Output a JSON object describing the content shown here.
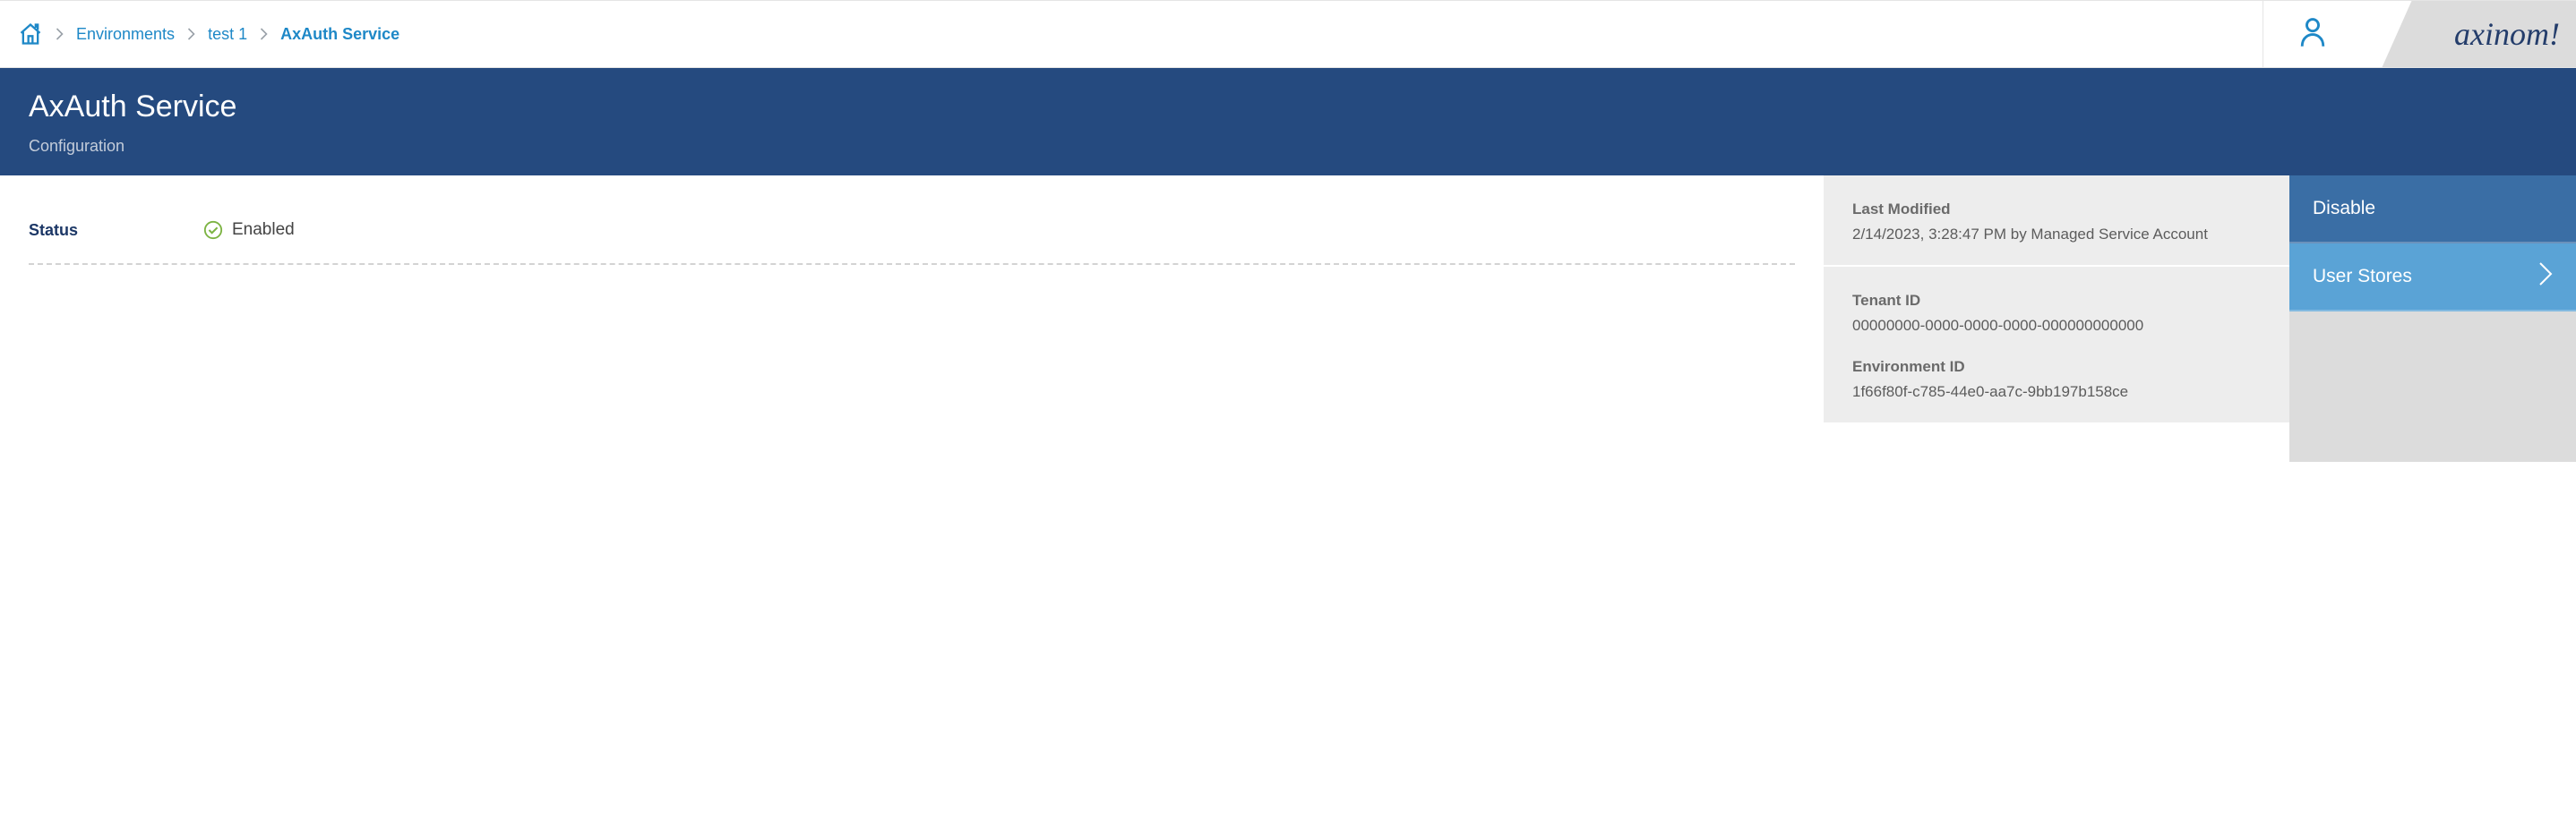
{
  "brand": "axinom!",
  "breadcrumbs": {
    "environments": "Environments",
    "test1": "test 1",
    "current": "AxAuth Service"
  },
  "hero": {
    "title": "AxAuth Service",
    "subtitle": "Configuration"
  },
  "status": {
    "label": "Status",
    "value": "Enabled"
  },
  "info": {
    "last_modified_label": "Last Modified",
    "last_modified_value": "2/14/2023, 3:28:47 PM by Managed Service Account",
    "tenant_id_label": "Tenant ID",
    "tenant_id_value": "00000000-0000-0000-0000-000000000000",
    "environment_id_label": "Environment ID",
    "environment_id_value": "1f66f80f-c785-44e0-aa7c-9bb197b158ce"
  },
  "actions": {
    "disable": "Disable",
    "user_stores": "User Stores"
  }
}
